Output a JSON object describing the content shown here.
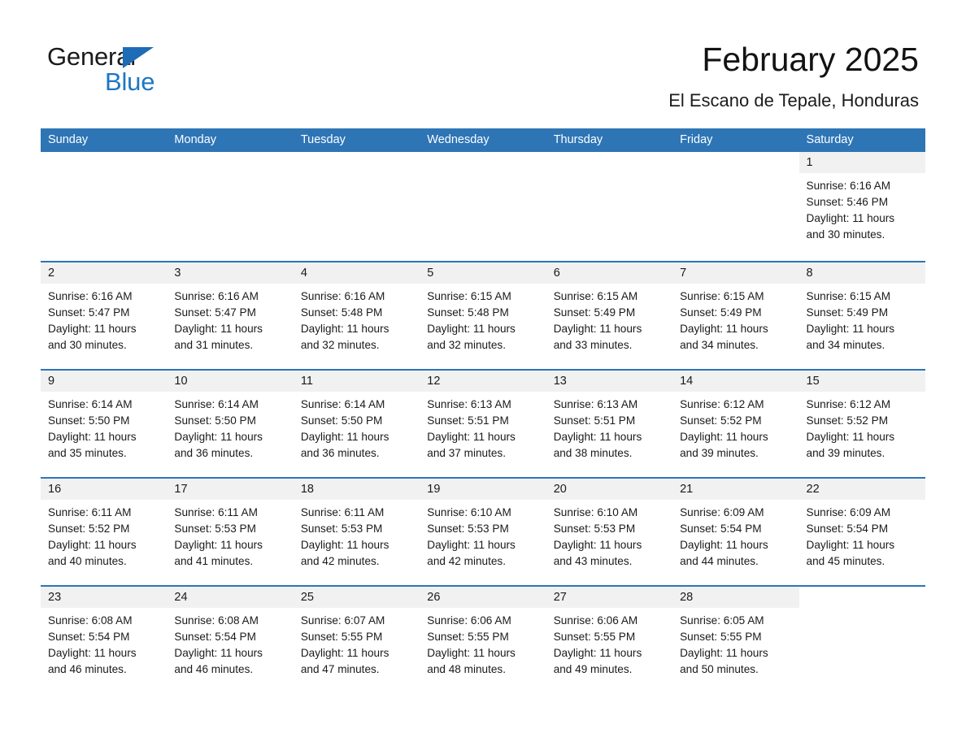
{
  "brand": {
    "name_part1": "General",
    "name_part2": "Blue",
    "accent_color": "#1e76c4"
  },
  "header": {
    "title": "February 2025",
    "subtitle": "El Escano de Tepale, Honduras"
  },
  "calendar": {
    "header_color": "#2e75b6",
    "weekdays": [
      "Sunday",
      "Monday",
      "Tuesday",
      "Wednesday",
      "Thursday",
      "Friday",
      "Saturday"
    ],
    "weeks": [
      [
        {
          "day": "",
          "blank": true
        },
        {
          "day": "",
          "blank": true
        },
        {
          "day": "",
          "blank": true
        },
        {
          "day": "",
          "blank": true
        },
        {
          "day": "",
          "blank": true
        },
        {
          "day": "",
          "blank": true
        },
        {
          "day": "1",
          "sunrise": "Sunrise: 6:16 AM",
          "sunset": "Sunset: 5:46 PM",
          "daylight1": "Daylight: 11 hours",
          "daylight2": "and 30 minutes."
        }
      ],
      [
        {
          "day": "2",
          "sunrise": "Sunrise: 6:16 AM",
          "sunset": "Sunset: 5:47 PM",
          "daylight1": "Daylight: 11 hours",
          "daylight2": "and 30 minutes."
        },
        {
          "day": "3",
          "sunrise": "Sunrise: 6:16 AM",
          "sunset": "Sunset: 5:47 PM",
          "daylight1": "Daylight: 11 hours",
          "daylight2": "and 31 minutes."
        },
        {
          "day": "4",
          "sunrise": "Sunrise: 6:16 AM",
          "sunset": "Sunset: 5:48 PM",
          "daylight1": "Daylight: 11 hours",
          "daylight2": "and 32 minutes."
        },
        {
          "day": "5",
          "sunrise": "Sunrise: 6:15 AM",
          "sunset": "Sunset: 5:48 PM",
          "daylight1": "Daylight: 11 hours",
          "daylight2": "and 32 minutes."
        },
        {
          "day": "6",
          "sunrise": "Sunrise: 6:15 AM",
          "sunset": "Sunset: 5:49 PM",
          "daylight1": "Daylight: 11 hours",
          "daylight2": "and 33 minutes."
        },
        {
          "day": "7",
          "sunrise": "Sunrise: 6:15 AM",
          "sunset": "Sunset: 5:49 PM",
          "daylight1": "Daylight: 11 hours",
          "daylight2": "and 34 minutes."
        },
        {
          "day": "8",
          "sunrise": "Sunrise: 6:15 AM",
          "sunset": "Sunset: 5:49 PM",
          "daylight1": "Daylight: 11 hours",
          "daylight2": "and 34 minutes."
        }
      ],
      [
        {
          "day": "9",
          "sunrise": "Sunrise: 6:14 AM",
          "sunset": "Sunset: 5:50 PM",
          "daylight1": "Daylight: 11 hours",
          "daylight2": "and 35 minutes."
        },
        {
          "day": "10",
          "sunrise": "Sunrise: 6:14 AM",
          "sunset": "Sunset: 5:50 PM",
          "daylight1": "Daylight: 11 hours",
          "daylight2": "and 36 minutes."
        },
        {
          "day": "11",
          "sunrise": "Sunrise: 6:14 AM",
          "sunset": "Sunset: 5:50 PM",
          "daylight1": "Daylight: 11 hours",
          "daylight2": "and 36 minutes."
        },
        {
          "day": "12",
          "sunrise": "Sunrise: 6:13 AM",
          "sunset": "Sunset: 5:51 PM",
          "daylight1": "Daylight: 11 hours",
          "daylight2": "and 37 minutes."
        },
        {
          "day": "13",
          "sunrise": "Sunrise: 6:13 AM",
          "sunset": "Sunset: 5:51 PM",
          "daylight1": "Daylight: 11 hours",
          "daylight2": "and 38 minutes."
        },
        {
          "day": "14",
          "sunrise": "Sunrise: 6:12 AM",
          "sunset": "Sunset: 5:52 PM",
          "daylight1": "Daylight: 11 hours",
          "daylight2": "and 39 minutes."
        },
        {
          "day": "15",
          "sunrise": "Sunrise: 6:12 AM",
          "sunset": "Sunset: 5:52 PM",
          "daylight1": "Daylight: 11 hours",
          "daylight2": "and 39 minutes."
        }
      ],
      [
        {
          "day": "16",
          "sunrise": "Sunrise: 6:11 AM",
          "sunset": "Sunset: 5:52 PM",
          "daylight1": "Daylight: 11 hours",
          "daylight2": "and 40 minutes."
        },
        {
          "day": "17",
          "sunrise": "Sunrise: 6:11 AM",
          "sunset": "Sunset: 5:53 PM",
          "daylight1": "Daylight: 11 hours",
          "daylight2": "and 41 minutes."
        },
        {
          "day": "18",
          "sunrise": "Sunrise: 6:11 AM",
          "sunset": "Sunset: 5:53 PM",
          "daylight1": "Daylight: 11 hours",
          "daylight2": "and 42 minutes."
        },
        {
          "day": "19",
          "sunrise": "Sunrise: 6:10 AM",
          "sunset": "Sunset: 5:53 PM",
          "daylight1": "Daylight: 11 hours",
          "daylight2": "and 42 minutes."
        },
        {
          "day": "20",
          "sunrise": "Sunrise: 6:10 AM",
          "sunset": "Sunset: 5:53 PM",
          "daylight1": "Daylight: 11 hours",
          "daylight2": "and 43 minutes."
        },
        {
          "day": "21",
          "sunrise": "Sunrise: 6:09 AM",
          "sunset": "Sunset: 5:54 PM",
          "daylight1": "Daylight: 11 hours",
          "daylight2": "and 44 minutes."
        },
        {
          "day": "22",
          "sunrise": "Sunrise: 6:09 AM",
          "sunset": "Sunset: 5:54 PM",
          "daylight1": "Daylight: 11 hours",
          "daylight2": "and 45 minutes."
        }
      ],
      [
        {
          "day": "23",
          "sunrise": "Sunrise: 6:08 AM",
          "sunset": "Sunset: 5:54 PM",
          "daylight1": "Daylight: 11 hours",
          "daylight2": "and 46 minutes."
        },
        {
          "day": "24",
          "sunrise": "Sunrise: 6:08 AM",
          "sunset": "Sunset: 5:54 PM",
          "daylight1": "Daylight: 11 hours",
          "daylight2": "and 46 minutes."
        },
        {
          "day": "25",
          "sunrise": "Sunrise: 6:07 AM",
          "sunset": "Sunset: 5:55 PM",
          "daylight1": "Daylight: 11 hours",
          "daylight2": "and 47 minutes."
        },
        {
          "day": "26",
          "sunrise": "Sunrise: 6:06 AM",
          "sunset": "Sunset: 5:55 PM",
          "daylight1": "Daylight: 11 hours",
          "daylight2": "and 48 minutes."
        },
        {
          "day": "27",
          "sunrise": "Sunrise: 6:06 AM",
          "sunset": "Sunset: 5:55 PM",
          "daylight1": "Daylight: 11 hours",
          "daylight2": "and 49 minutes."
        },
        {
          "day": "28",
          "sunrise": "Sunrise: 6:05 AM",
          "sunset": "Sunset: 5:55 PM",
          "daylight1": "Daylight: 11 hours",
          "daylight2": "and 50 minutes."
        },
        {
          "day": "",
          "blank": true
        }
      ]
    ]
  }
}
